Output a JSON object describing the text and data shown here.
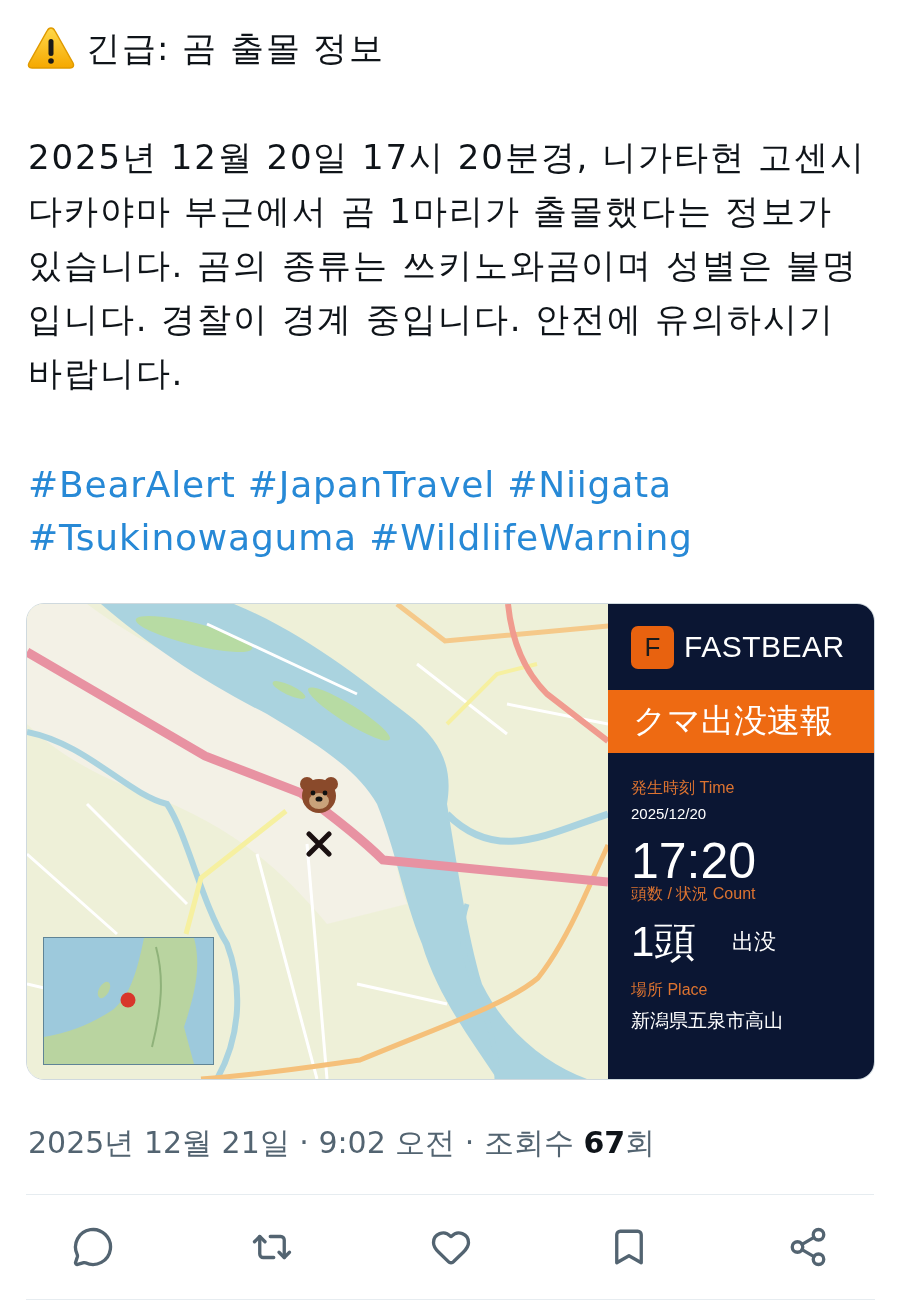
{
  "post": {
    "title": "긴급: 곰 출몰 정보",
    "body": "2025년 12월 20일 17시 20분경, 니가타현 고센시 다카야마 부근에서 곰 1마리가 출몰했다는 정보가 있습니다. 곰의 종류는 쓰키노와곰이며 성별은 불명입니다. 경찰이 경계 중입니다. 안전에 유의하시기 바랍니다.",
    "hashtags": [
      "#BearAlert",
      "#JapanTravel",
      "#Niigata",
      "#Tsukinowaguma",
      "#WildlifeWarning"
    ]
  },
  "card": {
    "logo_letter": "F",
    "brand": "FASTBEAR",
    "headline": "クマ出没速報",
    "time_label": "発生時刻 Time",
    "date": "2025/12/20",
    "time": "17:20",
    "count_label": "頭数 / 状況 Count",
    "count": "1頭",
    "status": "出没",
    "place_label": "場所 Place",
    "place": "新潟県五泉市高山"
  },
  "meta": "2025년 12월 21일 · 9:02 오전 · 조회수 **67**회"
}
